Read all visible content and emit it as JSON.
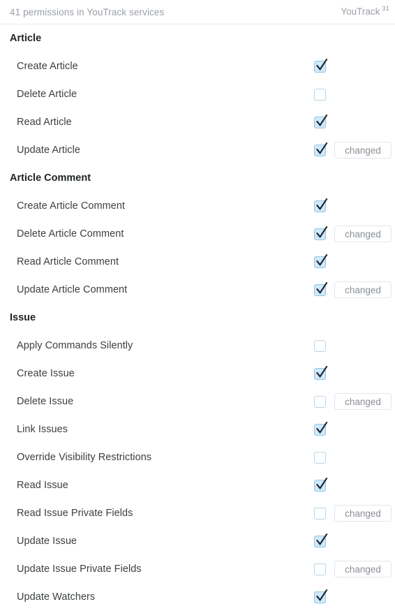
{
  "header": {
    "summary": "41 permissions in YouTrack services",
    "service_name": "YouTrack",
    "service_count": "31"
  },
  "labels": {
    "changed_badge": "changed"
  },
  "colors": {
    "checkbox_fill": "#cfe8fa",
    "checkbox_border": "#8fc7ea",
    "checkbox_empty_border": "#b8d6ea",
    "tick": "#1f2326",
    "header_text": "#9a9fa5",
    "row_text": "#3c4043",
    "section_text": "#1f2326",
    "badge_border": "#e3e6ea",
    "badge_text": "#8a8f96",
    "divider": "#e8e8e8"
  },
  "sections": [
    {
      "title": "Article",
      "rows": [
        {
          "label": "Create Article",
          "checked": true,
          "changed": false
        },
        {
          "label": "Delete Article",
          "checked": false,
          "changed": false
        },
        {
          "label": "Read Article",
          "checked": true,
          "changed": false
        },
        {
          "label": "Update Article",
          "checked": true,
          "changed": true
        }
      ]
    },
    {
      "title": "Article Comment",
      "rows": [
        {
          "label": "Create Article Comment",
          "checked": true,
          "changed": false
        },
        {
          "label": "Delete Article Comment",
          "checked": true,
          "changed": true
        },
        {
          "label": "Read Article Comment",
          "checked": true,
          "changed": false
        },
        {
          "label": "Update Article Comment",
          "checked": true,
          "changed": true
        }
      ]
    },
    {
      "title": "Issue",
      "rows": [
        {
          "label": "Apply Commands Silently",
          "checked": false,
          "changed": false
        },
        {
          "label": "Create Issue",
          "checked": true,
          "changed": false
        },
        {
          "label": "Delete Issue",
          "checked": false,
          "changed": true
        },
        {
          "label": "Link Issues",
          "checked": true,
          "changed": false
        },
        {
          "label": "Override Visibility Restrictions",
          "checked": false,
          "changed": false
        },
        {
          "label": "Read Issue",
          "checked": true,
          "changed": false
        },
        {
          "label": "Read Issue Private Fields",
          "checked": false,
          "changed": true
        },
        {
          "label": "Update Issue",
          "checked": true,
          "changed": false
        },
        {
          "label": "Update Issue Private Fields",
          "checked": false,
          "changed": true
        },
        {
          "label": "Update Watchers",
          "checked": true,
          "changed": false
        }
      ]
    }
  ]
}
